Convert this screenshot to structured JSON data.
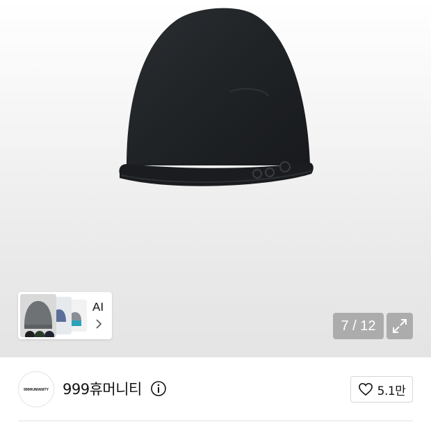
{
  "gallery": {
    "product_image": "black-knit-beanie",
    "ai_card": {
      "label": "AI",
      "chevron_icon": "chevron-right-icon"
    },
    "page_counter": "7 / 12",
    "expand_icon": "expand-icon"
  },
  "shop": {
    "logo_text": "999HUMANITY",
    "name": "999휴머니티",
    "info_icon": "info-icon",
    "like_icon": "heart-outline-icon",
    "like_count": "5.1만"
  },
  "colors": {
    "beanie": "#1f2225",
    "counter_bg": "#969696",
    "text": "#111111",
    "border": "#d6d6d6"
  }
}
